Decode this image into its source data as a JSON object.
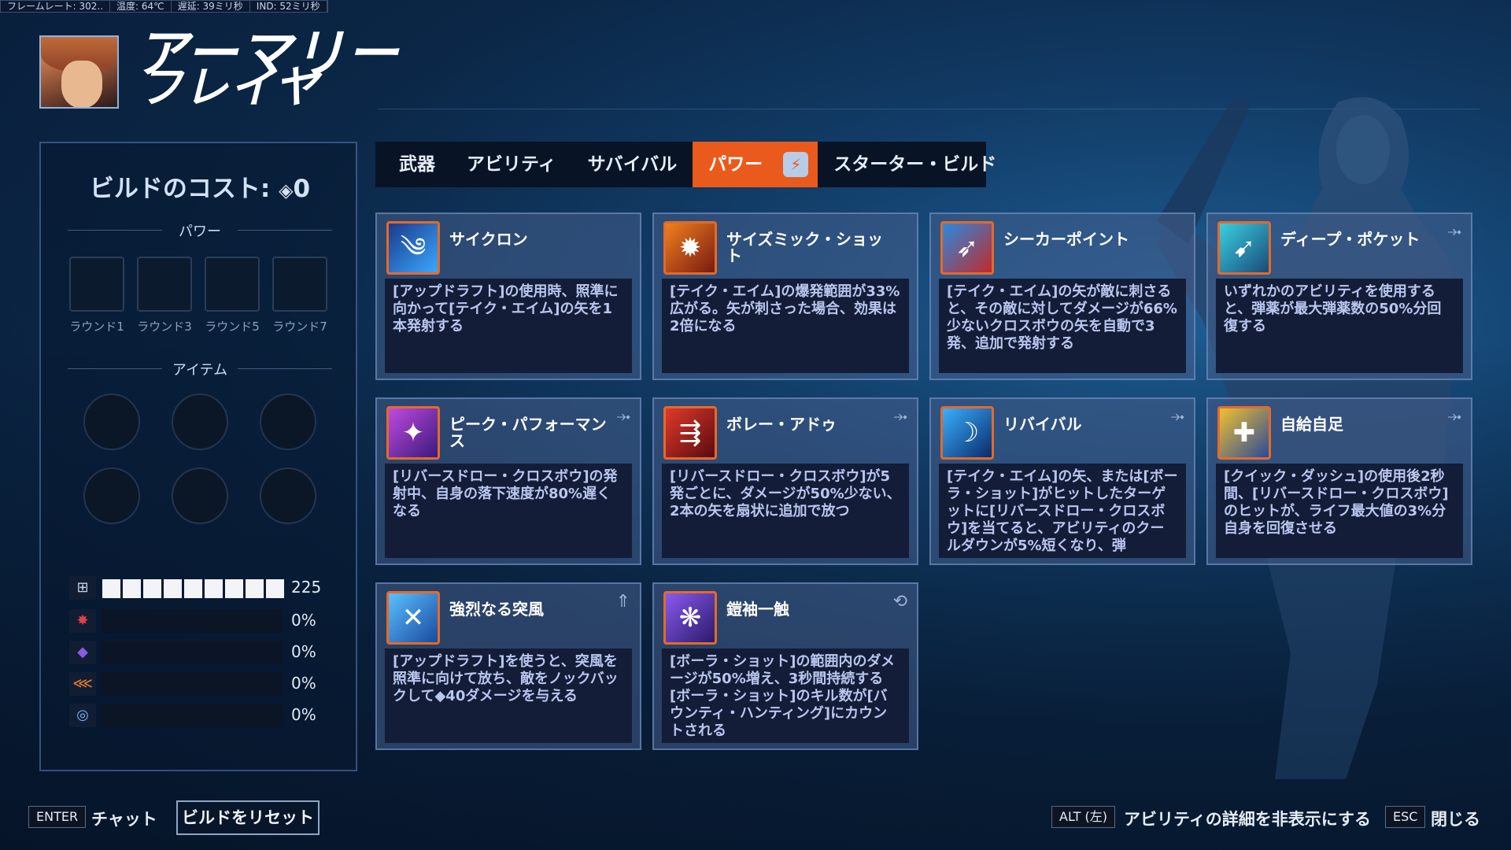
{
  "perf": [
    "フレームレート: 302..",
    "温度: 64℃",
    "遅延: 39ミリ秒",
    "IND: 52ミリ秒"
  ],
  "hero": {
    "name_line1": "アーマリー",
    "name_line2": "フレイヤ"
  },
  "build": {
    "cost_label": "ビルドのコスト:",
    "cost_icon": "◈",
    "cost_value": "0",
    "powers_label": "パワー",
    "rounds": [
      "ラウンド1",
      "ラウンド3",
      "ラウンド5",
      "ラウンド7"
    ],
    "items_label": "アイテム"
  },
  "stats": [
    {
      "icon": "health-icon",
      "glyph": "⊞",
      "value": "225",
      "segments": 9
    },
    {
      "icon": "weapon-icon",
      "glyph": "✸",
      "value": "0%"
    },
    {
      "icon": "ability-icon",
      "glyph": "◆",
      "value": "0%"
    },
    {
      "icon": "speed-icon",
      "glyph": "⋘",
      "value": "0%"
    },
    {
      "icon": "cooldown-icon",
      "glyph": "◎",
      "value": "0%"
    }
  ],
  "tabs": [
    "武器",
    "アビリティ",
    "サバイバル",
    "パワー",
    "スターター・ビルド"
  ],
  "active_tab": "パワー",
  "cards": [
    {
      "name": "サイクロン",
      "desc": "[アップドラフト]の使用時、照準に向かって[テイク・エイム]の矢を1本発射する",
      "corner": "",
      "color": "#2a6fd6"
    },
    {
      "name": "サイズミック・ショット",
      "desc": "[テイク・エイム]の爆発範囲が33%広がる。矢が刺さった場合、効果は2倍になる",
      "corner": "",
      "color": "#c8361a"
    },
    {
      "name": "シーカーポイント",
      "desc": "[テイク・エイム]の矢が敵に刺さると、その敵に対してダメージが66%少ないクロスボウの矢を自動で3発、追加で発射する",
      "corner": "",
      "color": "#1f8ad8"
    },
    {
      "name": "ディープ・ポケット",
      "desc": "いずれかのアビリティを使用すると、弾薬が最大弾薬数の50%分回復する",
      "corner": "⤞",
      "color": "#2aa0b8"
    },
    {
      "name": "ピーク・パフォーマンス",
      "desc": "[リバースドロー・クロスボウ]の発射中、自身の落下速度が80%遅くなる",
      "corner": "⤞",
      "color": "#9a2ad0"
    },
    {
      "name": "ボレー・アドゥ",
      "desc": "[リバースドロー・クロスボウ]が5発ごとに、ダメージが50%少ない、2本の矢を扇状に追加で放つ",
      "corner": "⤞",
      "color": "#b82a22"
    },
    {
      "name": "リバイバル",
      "desc": "[テイク・エイム]の矢、または[ボーラ・ショット]がヒットしたターゲットに[リバースドロー・クロスボウ]を当てると、アビリティのクールダウンが5%短くなり、弾",
      "corner": "⤞",
      "color": "#1e6ad0"
    },
    {
      "name": "自給自足",
      "desc": "[クイック・ダッシュ]の使用後2秒間、[リバースドロー・クロスボウ]のヒットが、ライフ最大値の3%分自身を回復させる",
      "corner": "⤞",
      "color": "#e6a21a"
    },
    {
      "name": "強烈なる突風",
      "desc": "[アップドラフト]を使うと、突風を照準に向けて放ち、敵をノックバックして◆40ダメージを与える",
      "corner": "⇑",
      "color": "#3a9ae0"
    },
    {
      "name": "鎧袖一触",
      "desc": "[ボーラ・ショット]の範囲内のダメージが50%増え、3秒間持続する[ボーラ・ショット]のキル数が[バウンティ・ハンティング]にカウントされる",
      "corner": "⟲",
      "color": "#6a3ad0"
    }
  ],
  "bottom": {
    "enter_key": "ENTER",
    "chat_label": "チャット",
    "reset_label": "ビルドをリセット",
    "alt_key": "ALT (左)",
    "hide_details_label": "アビリティの詳細を非表示にする",
    "esc_key": "ESC",
    "close_label": "閉じる"
  },
  "colors": {
    "accent": "#ea5a1c",
    "panel": "#0b2848",
    "card_desc_text": "#b9c6ee"
  }
}
